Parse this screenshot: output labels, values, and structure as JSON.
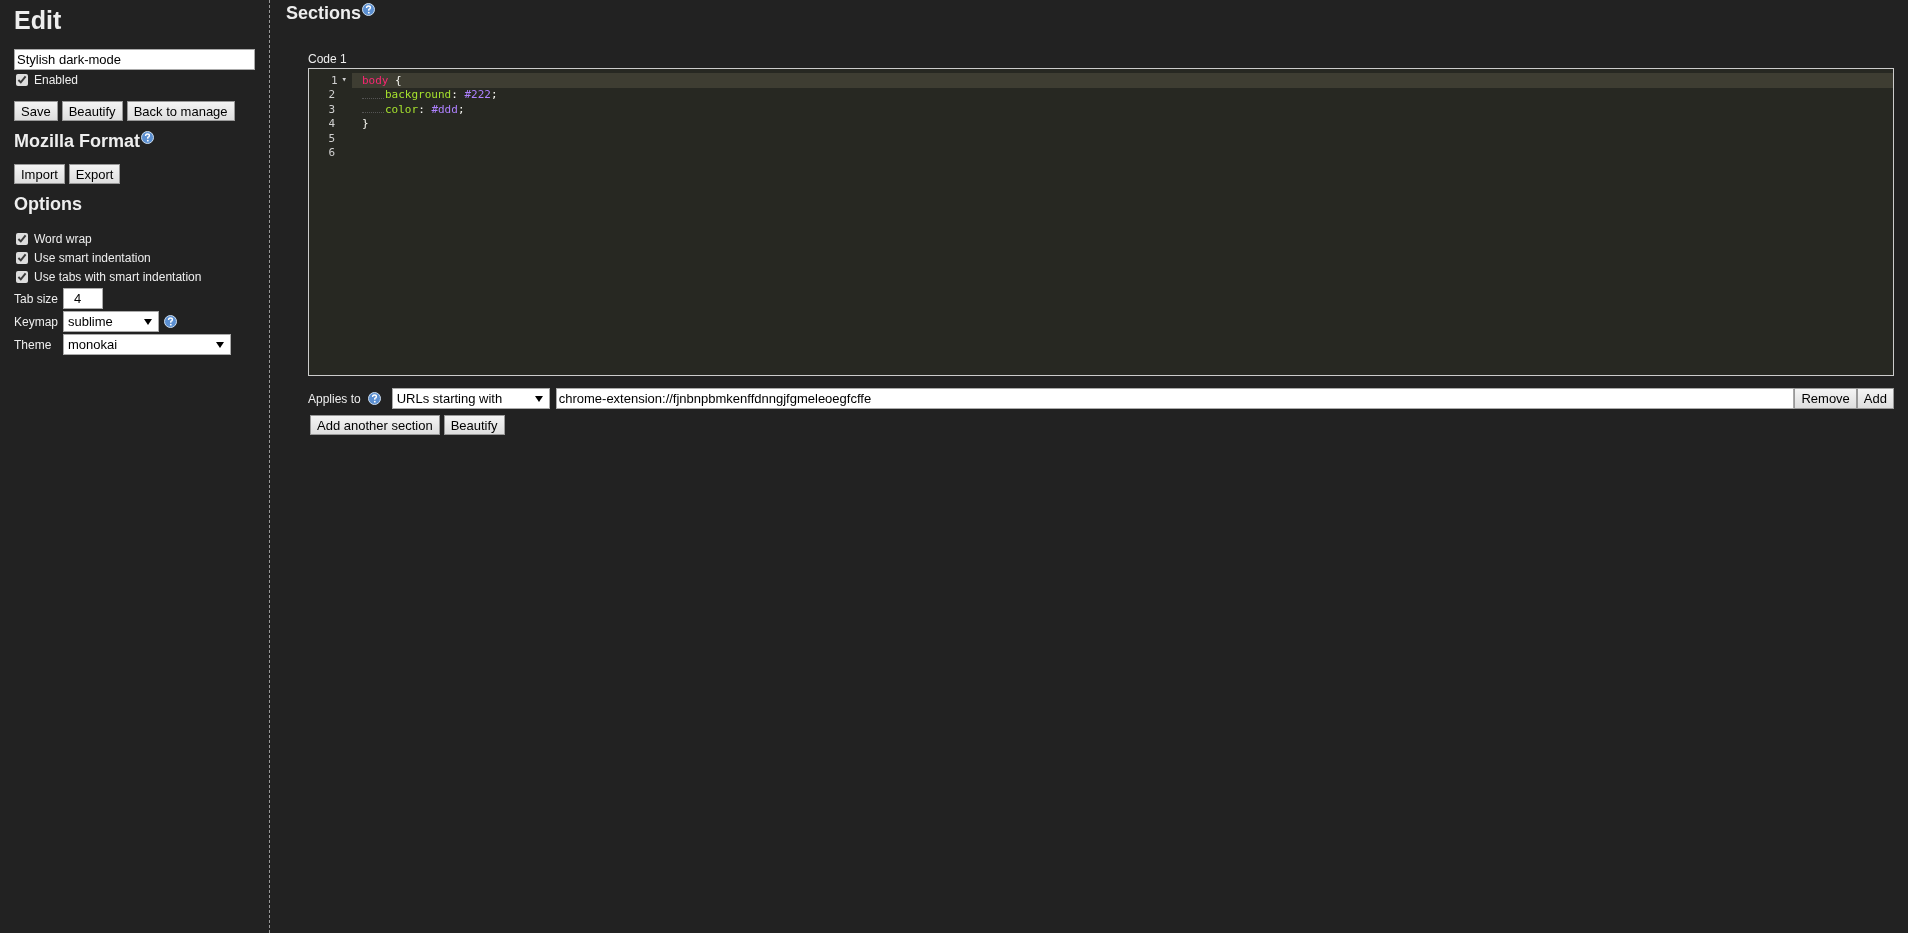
{
  "sidebar": {
    "title": "Edit",
    "name_field": {
      "value": "Stylish dark-mode"
    },
    "enabled": {
      "label": "Enabled",
      "checked": true
    },
    "buttons": [
      "Save",
      "Beautify",
      "Back to manage"
    ],
    "mozilla_format": {
      "title": "Mozilla Format",
      "buttons": [
        "Import",
        "Export"
      ]
    },
    "options": {
      "title": "Options",
      "checkboxes": [
        {
          "label": "Word wrap",
          "checked": true
        },
        {
          "label": "Use smart indentation",
          "checked": true
        },
        {
          "label": "Use tabs with smart indentation",
          "checked": true
        }
      ],
      "tab_size": {
        "label": "Tab size",
        "value": "4"
      },
      "keymap": {
        "label": "Keymap",
        "value": "sublime"
      },
      "theme": {
        "label": "Theme",
        "value": "monokai"
      }
    }
  },
  "sections": {
    "title": "Sections",
    "items": [
      {
        "label": "Code 1",
        "lines": [
          {
            "number": "1",
            "fold": "▾",
            "active": true,
            "indented": false,
            "tokens": [
              {
                "kind": "selector",
                "text": "body"
              },
              {
                "kind": "plain",
                "text": " {"
              }
            ]
          },
          {
            "number": "2",
            "active": false,
            "indented": true,
            "tokens": [
              {
                "kind": "property",
                "text": "background"
              },
              {
                "kind": "plain",
                "text": ": "
              },
              {
                "kind": "value",
                "text": "#222"
              },
              {
                "kind": "plain",
                "text": ";"
              }
            ]
          },
          {
            "number": "3",
            "active": false,
            "indented": true,
            "tokens": [
              {
                "kind": "property",
                "text": "color"
              },
              {
                "kind": "plain",
                "text": ": "
              },
              {
                "kind": "value",
                "text": "#ddd"
              },
              {
                "kind": "plain",
                "text": ";"
              }
            ]
          },
          {
            "number": "4",
            "active": false,
            "indented": false,
            "tokens": [
              {
                "kind": "plain",
                "text": "}"
              }
            ]
          },
          {
            "number": "5",
            "active": false,
            "indented": false
          },
          {
            "number": "6",
            "active": false,
            "indented": false
          }
        ],
        "applies": {
          "label": "Applies to",
          "type": "URLs starting with",
          "value": "chrome-extension://fjnbnpbmkenffdnngjfgmeleoegfcffe",
          "buttons": [
            "Remove",
            "Add"
          ]
        },
        "buttons": [
          "Add another section",
          "Beautify"
        ]
      }
    ]
  }
}
